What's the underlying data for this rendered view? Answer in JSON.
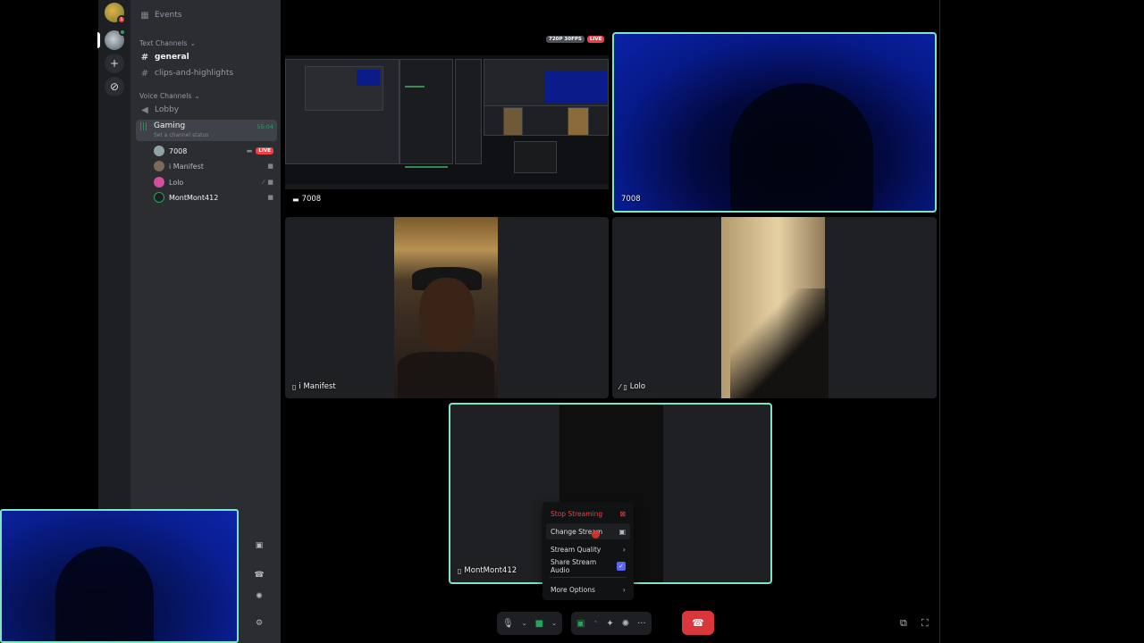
{
  "colors": {
    "accent_green": "#23a55a",
    "live_red": "#f23f43",
    "selected_border": "#7ee6c4",
    "checkbox_blue": "#5865f2",
    "hangup_red": "#da373c"
  },
  "rail": {
    "server1_badge": "1"
  },
  "sidebar": {
    "events_label": "Events",
    "text_category": "Text Channels",
    "text_channels": [
      {
        "name": "general",
        "active": true
      },
      {
        "name": "clips-and-highlights",
        "active": false
      }
    ],
    "voice_category": "Voice Channels",
    "lobby": "Lobby",
    "gaming": {
      "name": "Gaming",
      "status": "Set a channel status",
      "timer": "55:04"
    },
    "voice_users": [
      {
        "name": "7008",
        "live": "LIVE",
        "icon": "screen-icon"
      },
      {
        "name": "i Manifest",
        "icon": "video-icon"
      },
      {
        "name": "Lolo",
        "icon": "video-icon"
      },
      {
        "name": "MontMont412",
        "icon": "video-icon"
      }
    ]
  },
  "stage": {
    "stream_badges": {
      "quality": "720P 30FPS",
      "live": "LIVE"
    },
    "tiles": [
      {
        "label": "7008",
        "kind": "stream"
      },
      {
        "label": "7008",
        "kind": "camera"
      },
      {
        "label": "i Manifest",
        "kind": "camera"
      },
      {
        "label": "Lolo",
        "kind": "camera"
      },
      {
        "label": "MontMont412",
        "kind": "camera"
      }
    ]
  },
  "context_menu": {
    "items": [
      {
        "label": "Stop Streaming",
        "icon": "stop-stream-icon"
      },
      {
        "label": "Change Stream",
        "icon": "change-stream-icon"
      },
      {
        "label": "Stream Quality",
        "icon": "chevron-right-icon"
      },
      {
        "label": "Share Stream Audio",
        "icon": "checkbox-checked-icon",
        "checked": true
      },
      {
        "label": "More Options",
        "icon": "chevron-right-icon"
      }
    ]
  },
  "controls": {
    "icons": [
      "microphone-icon",
      "camera-icon",
      "screen-share-icon",
      "activities-icon",
      "soundboard-icon",
      "more-icon",
      "hangup-icon",
      "popout-icon",
      "fullscreen-icon"
    ]
  }
}
